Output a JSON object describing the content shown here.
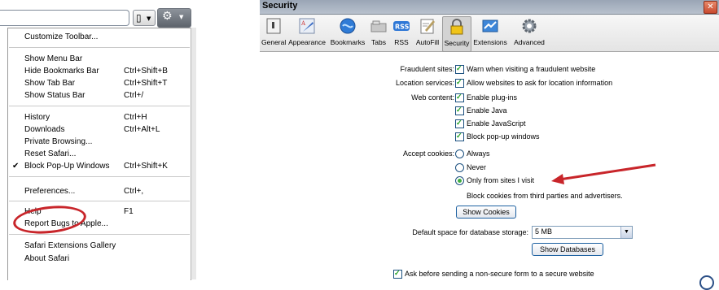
{
  "left": {
    "toolbar": {
      "page_icon": "page-menu-icon",
      "gear_icon": "gear-icon"
    },
    "menu": {
      "items": [
        {
          "label": "Customize Toolbar...",
          "shortcut": ""
        },
        {
          "label": "Show Menu Bar",
          "shortcut": ""
        },
        {
          "label": "Hide Bookmarks Bar",
          "shortcut": "Ctrl+Shift+B"
        },
        {
          "label": "Show Tab Bar",
          "shortcut": "Ctrl+Shift+T"
        },
        {
          "label": "Show Status Bar",
          "shortcut": "Ctrl+/"
        },
        {
          "label": "History",
          "shortcut": "Ctrl+H"
        },
        {
          "label": "Downloads",
          "shortcut": "Ctrl+Alt+L"
        },
        {
          "label": "Private Browsing...",
          "shortcut": ""
        },
        {
          "label": "Reset Safari...",
          "shortcut": ""
        },
        {
          "label": "Block Pop-Up Windows",
          "shortcut": "Ctrl+Shift+K",
          "checked": true
        },
        {
          "label": "Preferences...",
          "shortcut": "Ctrl+,"
        },
        {
          "label": "Help",
          "shortcut": "F1"
        },
        {
          "label": "Report Bugs to Apple...",
          "shortcut": ""
        },
        {
          "label": "Safari Extensions Gallery",
          "shortcut": ""
        },
        {
          "label": "About Safari",
          "shortcut": ""
        }
      ]
    },
    "highlight_color": "#c8252a"
  },
  "right": {
    "window_title": "Security",
    "toolbar_tabs": [
      {
        "label": "General",
        "icon": "general-icon"
      },
      {
        "label": "Appearance",
        "icon": "appearance-icon"
      },
      {
        "label": "Bookmarks",
        "icon": "bookmarks-icon"
      },
      {
        "label": "Tabs",
        "icon": "tabs-icon"
      },
      {
        "label": "RSS",
        "icon": "rss-icon"
      },
      {
        "label": "AutoFill",
        "icon": "autofill-icon"
      },
      {
        "label": "Security",
        "icon": "lock-icon",
        "selected": true
      },
      {
        "label": "Extensions",
        "icon": "extensions-icon"
      },
      {
        "label": "Advanced",
        "icon": "gear-icon"
      }
    ],
    "fraudulent": {
      "label": "Fraudulent sites:",
      "option": "Warn when visiting a fraudulent website",
      "checked": true
    },
    "location": {
      "label": "Location services:",
      "option": "Allow websites to ask for location information",
      "checked": true
    },
    "web_content": {
      "label": "Web content:",
      "options": [
        {
          "label": "Enable plug-ins",
          "checked": true
        },
        {
          "label": "Enable Java",
          "checked": true
        },
        {
          "label": "Enable JavaScript",
          "checked": true
        },
        {
          "label": "Block pop-up windows",
          "checked": true
        }
      ]
    },
    "cookies": {
      "label": "Accept cookies:",
      "options": [
        {
          "label": "Always",
          "selected": false
        },
        {
          "label": "Never",
          "selected": false
        },
        {
          "label": "Only from sites I visit",
          "selected": true
        }
      ],
      "note": "Block cookies from third parties and advertisers.",
      "show_button": "Show Cookies"
    },
    "database": {
      "label": "Default space for database storage:",
      "value": "5 MB",
      "show_button": "Show Databases"
    },
    "nonsecure": {
      "label": "Ask before sending a non-secure form to a secure website",
      "checked": true
    },
    "arrow_color": "#c8252a"
  }
}
